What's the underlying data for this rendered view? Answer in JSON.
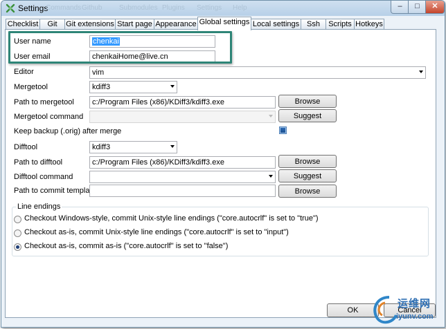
{
  "window": {
    "title": "Settings",
    "ghost_menu": [
      "Commands",
      "Github",
      "Submodules",
      "Plugins",
      "Settings",
      "Help"
    ],
    "min_glyph": "–",
    "max_glyph": "□",
    "close_glyph": "✕"
  },
  "tabs": [
    "Checklist",
    "Git",
    "Git extensions",
    "Start page",
    "Appearance",
    "Global settings",
    "Local settings",
    "Ssh",
    "Scripts",
    "Hotkeys"
  ],
  "active_tab": "Global settings",
  "fields": {
    "user_name_label": "User name",
    "user_name_value": "chenkai",
    "user_email_label": "User email",
    "user_email_value": "chenkaiHome@live.cn",
    "editor_label": "Editor",
    "editor_value": "vim",
    "mergetool_label": "Mergetool",
    "mergetool_value": "kdiff3",
    "path_mergetool_label": "Path to mergetool",
    "path_mergetool_value": "c:/Program Files (x86)/KDiff3/kdiff3.exe",
    "mergetool_command_label": "Mergetool command",
    "mergetool_command_value": "",
    "keep_backup_label": "Keep backup (.orig) after merge",
    "keep_backup_checked": true,
    "difftool_label": "Difftool",
    "difftool_value": "kdiff3",
    "path_difftool_label": "Path to difftool",
    "path_difftool_value": "c:/Program Files (x86)/KDiff3/kdiff3.exe",
    "difftool_command_label": "Difftool command",
    "difftool_command_value": "",
    "path_commit_template_label": "Path to commit template",
    "path_commit_template_value": ""
  },
  "buttons": {
    "browse": "Browse",
    "suggest": "Suggest",
    "ok": "OK",
    "cancel": "Cancel"
  },
  "line_endings": {
    "title": "Line endings",
    "options": [
      "Checkout Windows-style, commit Unix-style line endings (\"core.autocrlf\"  is set to \"true\")",
      "Checkout as-is, commit Unix-style line endings (\"core.autocrlf\"  is set to \"input\")",
      "Checkout as-is, commit as-is (\"core.autocrlf\"  is set to \"false\")"
    ],
    "selected_index": 2
  },
  "watermark": {
    "cn": "运维网",
    "en": "iyunv.com"
  },
  "colors": {
    "highlight_border": "#2e8577",
    "selection": "#3399ff"
  }
}
